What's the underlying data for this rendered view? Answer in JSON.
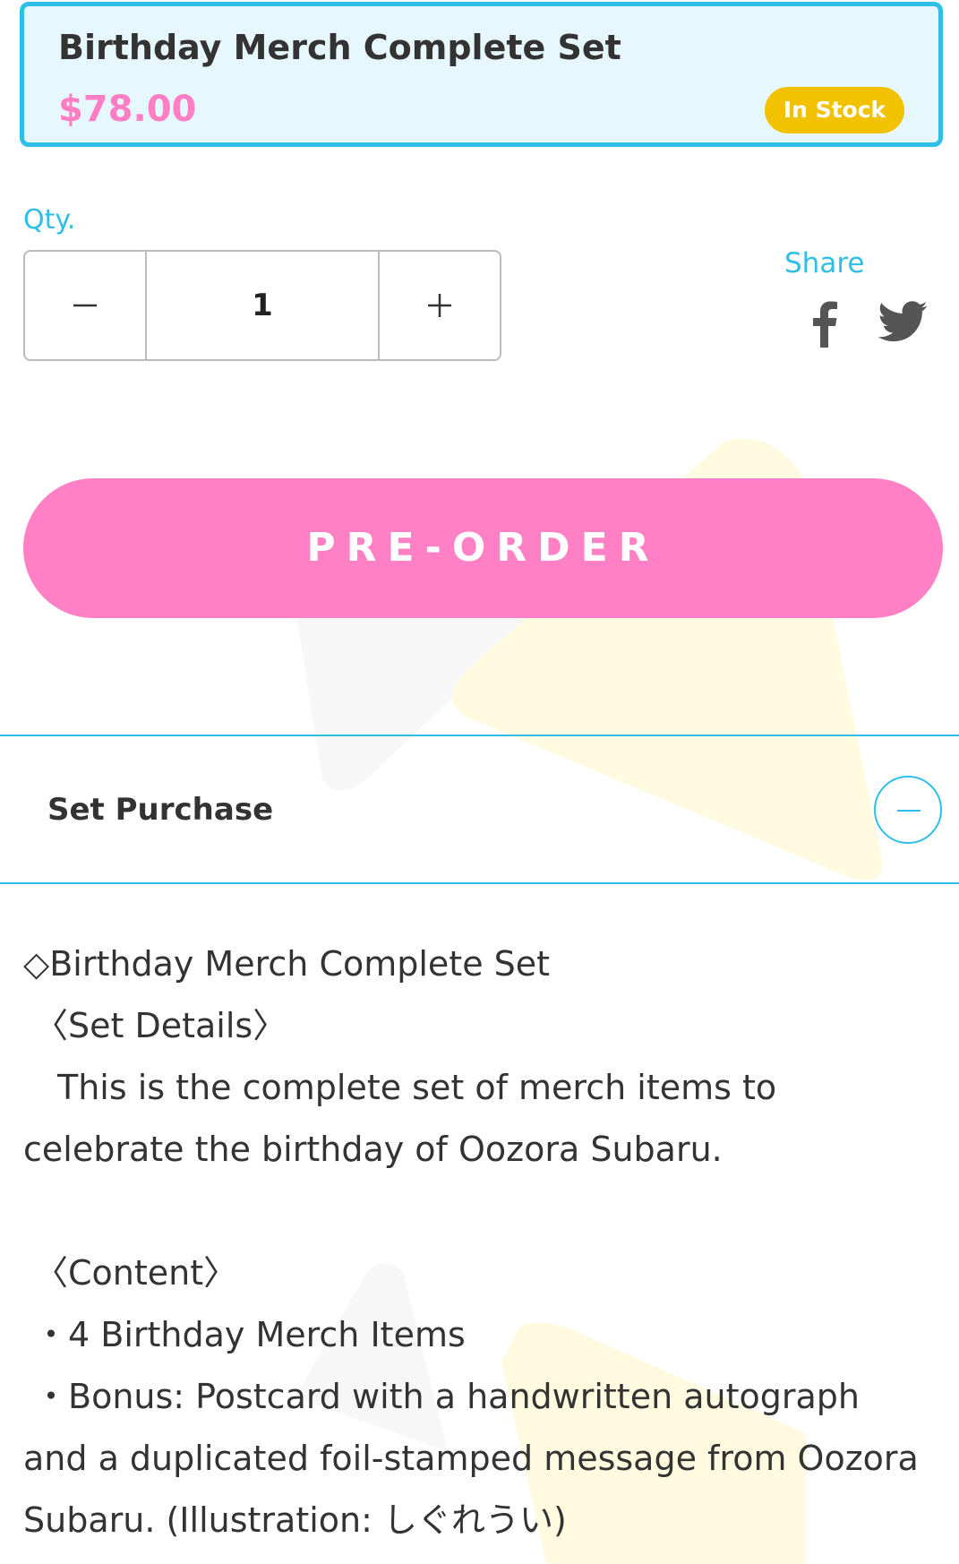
{
  "product": {
    "title": "Birthday Merch Complete Set",
    "price": "$78.00",
    "stock_status": "In Stock"
  },
  "quantity": {
    "label": "Qty.",
    "value": "1",
    "decrement_icon": "minus-icon",
    "increment_icon": "plus-icon"
  },
  "share": {
    "label": "Share",
    "icons": [
      "facebook-icon",
      "twitter-icon"
    ]
  },
  "preorder": {
    "label": "PRE-ORDER"
  },
  "set_purchase": {
    "title": "Set Purchase",
    "toggle_icon": "collapse-minus-icon",
    "description": {
      "heading": "◇Birthday Merch Complete Set",
      "details_header": "〈Set Details〉",
      "details_line1": "　This is the complete set of merch items to",
      "details_line2": "celebrate the birthday of Oozora Subaru.",
      "content_header": "〈Content〉",
      "content_item1": "・4 Birthday Merch Items",
      "content_item2_line1": "・Bonus: Postcard with a handwritten autograph",
      "content_item2_line2": "and a duplicated foil-stamped message from Oozora",
      "content_item2_line3": "Subaru. (Illustration: しぐれうい)"
    }
  },
  "colors": {
    "accent_blue": "#2fbfe6",
    "card_background": "#e6f7fd",
    "price_pink": "#ff7ec4",
    "button_pink": "#ff80c4",
    "badge_yellow": "#f2c200",
    "deco_yellow": "#fffae0",
    "deco_gray": "#f7f7f7"
  }
}
